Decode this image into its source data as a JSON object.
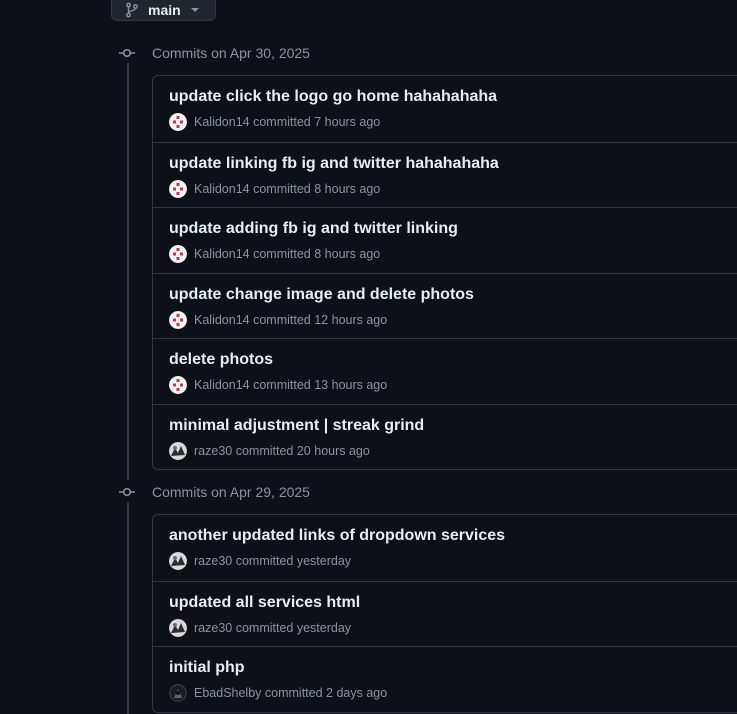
{
  "branch": {
    "name": "main"
  },
  "groups": [
    {
      "title": "Commits on Apr 30, 2025",
      "commits": [
        {
          "title": "update click the logo go home hahahahaha",
          "author": "Kalidon14",
          "action": "committed",
          "time": "7 hours ago",
          "avatar": "kalidon"
        },
        {
          "title": "update linking fb ig and twitter hahahahaha",
          "author": "Kalidon14",
          "action": "committed",
          "time": "8 hours ago",
          "avatar": "kalidon"
        },
        {
          "title": "update adding fb ig and twitter linking",
          "author": "Kalidon14",
          "action": "committed",
          "time": "8 hours ago",
          "avatar": "kalidon"
        },
        {
          "title": "update change image and delete photos",
          "author": "Kalidon14",
          "action": "committed",
          "time": "12 hours ago",
          "avatar": "kalidon"
        },
        {
          "title": "delete photos",
          "author": "Kalidon14",
          "action": "committed",
          "time": "13 hours ago",
          "avatar": "kalidon"
        },
        {
          "title": "minimal adjustment | streak grind",
          "author": "raze30",
          "action": "committed",
          "time": "20 hours ago",
          "avatar": "raze"
        }
      ]
    },
    {
      "title": "Commits on Apr 29, 2025",
      "commits": [
        {
          "title": "another updated links of dropdown services",
          "author": "raze30",
          "action": "committed",
          "time": "yesterday",
          "avatar": "raze"
        },
        {
          "title": "updated all services html",
          "author": "raze30",
          "action": "committed",
          "time": "yesterday",
          "avatar": "raze"
        },
        {
          "title": "initial php",
          "author": "EbadShelby",
          "action": "committed",
          "time": "2 days ago",
          "avatar": "ebad"
        }
      ]
    }
  ],
  "colors": {
    "background": "#0d1117",
    "border": "#30363d",
    "text": "#e6edf3",
    "muted": "#8b949e"
  },
  "icons": {
    "branch": "git-branch-icon",
    "commit": "git-commit-icon",
    "caret": "caret-down-icon"
  }
}
